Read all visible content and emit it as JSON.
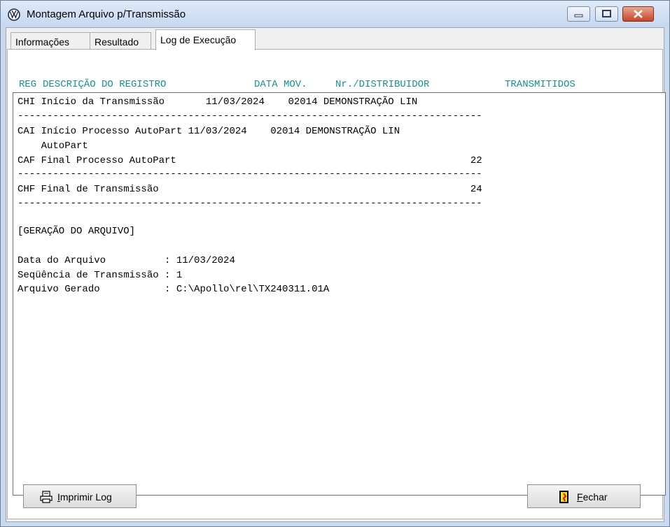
{
  "window": {
    "title": "Montagem Arquivo p/Transmissão"
  },
  "tabs": [
    {
      "label": "Informações"
    },
    {
      "label": "Resultado"
    },
    {
      "label": "Log de Execução"
    }
  ],
  "columns": {
    "reg": "REG",
    "descricao": "DESCRIÇÃO DO REGISTRO",
    "data_mov": "DATA MOV.",
    "distribuidor": "Nr./DISTRIBUIDOR",
    "transmitidos": "TRANSMITIDOS"
  },
  "log_lines": [
    "CHI Início da Transmissão       11/03/2024    02014 DEMONSTRAÇÃO LIN",
    "-------------------------------------------------------------------------------",
    "CAI Início Processo AutoPart 11/03/2024    02014 DEMONSTRAÇÃO LIN",
    "    AutoPart",
    "CAF Final Processo AutoPart                                                  22",
    "-------------------------------------------------------------------------------",
    "CHF Final de Transmissão                                                     24",
    "-------------------------------------------------------------------------------",
    "",
    "[GERAÇÃO DO ARQUIVO]",
    "",
    "Data do Arquivo          : 11/03/2024",
    "Seqüência de Transmissão : 1",
    "Arquivo Gerado           : C:\\Apollo\\rel\\TX240311.01A"
  ],
  "buttons": {
    "print": {
      "mnemonic": "I",
      "rest": "mprimir Log",
      "icon": "printer-icon"
    },
    "close": {
      "mnemonic": "F",
      "rest": "echar",
      "icon": "exit-door-icon"
    }
  }
}
